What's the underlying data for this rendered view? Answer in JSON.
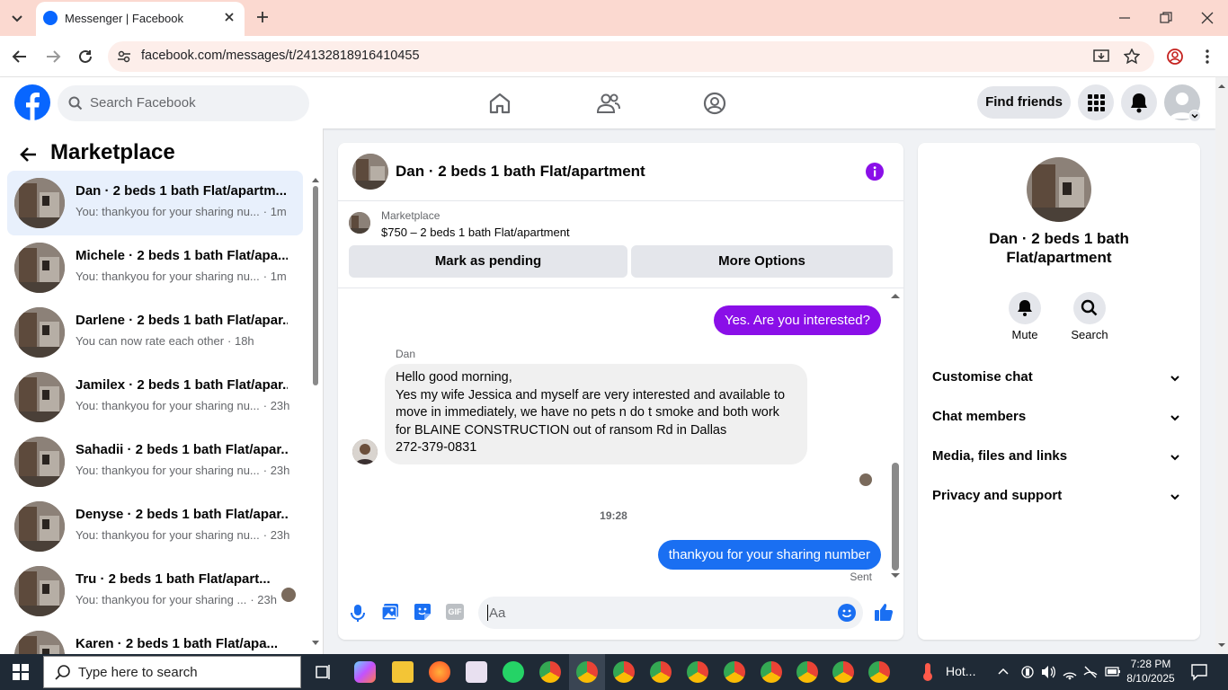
{
  "browser": {
    "tab_title": "Messenger | Facebook",
    "url": "facebook.com/messages/t/24132818916410455"
  },
  "fb_header": {
    "search_placeholder": "Search Facebook",
    "find_friends": "Find friends"
  },
  "left_panel": {
    "title": "Marketplace",
    "conversations": [
      {
        "title": "Dan · 2 beds 1 bath Flat/apartm...",
        "preview": "You: thankyou for your sharing nu...",
        "time": "· 1m",
        "active": true
      },
      {
        "title": "Michele · 2 beds 1 bath Flat/apa...",
        "preview": "You: thankyou for your sharing nu...",
        "time": "· 1m"
      },
      {
        "title": "Darlene · 2 beds 1 bath Flat/apar...",
        "preview": "You can now rate each other",
        "time": "· 18h"
      },
      {
        "title": "Jamilex · 2 beds 1 bath Flat/apar...",
        "preview": "You: thankyou for your sharing nu...",
        "time": "· 23h"
      },
      {
        "title": "Sahadii · 2 beds 1 bath Flat/apar...",
        "preview": "You: thankyou for your sharing nu...",
        "time": "· 23h"
      },
      {
        "title": "Denyse · 2 beds 1 bath Flat/apar...",
        "preview": "You: thankyou for your sharing nu...",
        "time": "· 23h"
      },
      {
        "title": "Tru · 2 beds 1 bath Flat/apart...",
        "preview": "You: thankyou for your sharing ...",
        "time": "· 23h"
      },
      {
        "title": "Karen · 2 beds 1 bath Flat/apa...",
        "preview": "",
        "time": ""
      }
    ]
  },
  "chat": {
    "title": "Dan · 2 beds 1 bath Flat/apartment",
    "listing_label": "Marketplace",
    "listing_detail": "$750 – 2 beds 1 bath Flat/apartment",
    "mark_pending": "Mark as pending",
    "more_options": "More Options",
    "msg_out_1": "Yes. Are you interested?",
    "sender_name": "Dan",
    "msg_in_lines": [
      "Hello good morning,",
      "Yes my wife Jessica and myself are very interested and available to",
      "move in immediately, we have no pets n do t smoke and both work",
      "for BLAINE CONSTRUCTION out of ransom Rd in Dallas",
      "272-379-0831"
    ],
    "timestamp": "19:28",
    "msg_out_2": "thankyou for your sharing number",
    "status": "Sent",
    "composer_placeholder": "Aa"
  },
  "right_panel": {
    "name_line1": "Dan · 2 beds 1 bath",
    "name_line2": "Flat/apartment",
    "mute": "Mute",
    "search": "Search",
    "sections": [
      "Customise chat",
      "Chat members",
      "Media, files and links",
      "Privacy and support"
    ]
  },
  "taskbar": {
    "search_placeholder": "Type here to search",
    "weather": "Hot...",
    "time": "7:28 PM",
    "date": "8/10/2025"
  },
  "colors": {
    "fb_blue": "#0866ff",
    "purple_bubble": "#8a0fe8",
    "blue_bubble": "#1a6ff2"
  }
}
